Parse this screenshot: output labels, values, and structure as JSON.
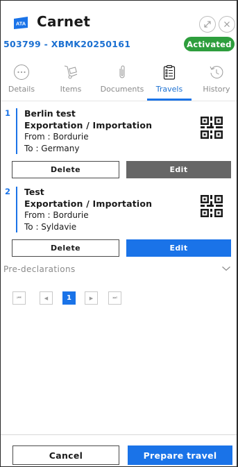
{
  "app": {
    "logo_text": "ATA",
    "title": "Carnet",
    "carnet_id": "503799 - XBMK20250161",
    "status": "Activated",
    "colors": {
      "accent": "#1a73e8",
      "status": "#2e9e3d",
      "edit_disabled": "#666666"
    }
  },
  "header": {
    "icons": {
      "expand": "expand-icon",
      "close": "close-icon"
    }
  },
  "tabs": [
    {
      "label": "Details",
      "icon": "ellipsis-circle-icon",
      "active": false
    },
    {
      "label": "Items",
      "icon": "hand-truck-icon",
      "active": false
    },
    {
      "label": "Documents",
      "icon": "paperclip-icon",
      "active": false
    },
    {
      "label": "Travels",
      "icon": "clipboard-list-icon",
      "active": true
    },
    {
      "label": "History",
      "icon": "history-clock-icon",
      "active": false
    }
  ],
  "travels": [
    {
      "number": "1",
      "name": "Berlin test",
      "type": "Exportation / Importation",
      "from": "From : Bordurie",
      "to": "To : Germany",
      "delete_label": "Delete",
      "edit_label": "Edit"
    },
    {
      "number": "2",
      "name": "Test",
      "type": "Exportation / Importation",
      "from": "From : Bordurie",
      "to": "To : Syldavie",
      "delete_label": "Delete",
      "edit_label": "Edit"
    }
  ],
  "predeclarations": {
    "label": "Pre-declarations"
  },
  "pagination": {
    "first": "⏮",
    "prev": "◀",
    "current": "1",
    "next": "▶",
    "last": "⏭"
  },
  "footer": {
    "cancel_label": "Cancel",
    "prepare_label": "Prepare travel"
  }
}
